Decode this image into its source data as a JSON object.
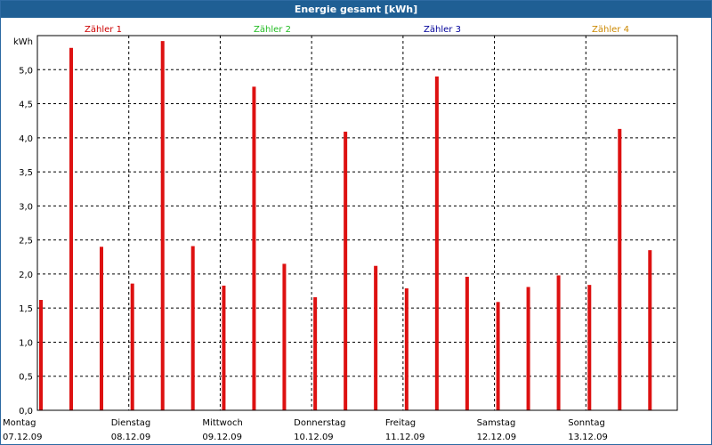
{
  "window": {
    "title": "Energie gesamt [kWh]"
  },
  "legend": [
    {
      "label": "Zähler 1",
      "color": "#cc0000"
    },
    {
      "label": "Zähler 2",
      "color": "#22bb22"
    },
    {
      "label": "Zähler 3",
      "color": "#000099"
    },
    {
      "label": "Zähler 4",
      "color": "#cc8800"
    }
  ],
  "chart_data": {
    "type": "bar",
    "title": "Energie gesamt [kWh]",
    "ylabel": "kWh",
    "ylim": [
      0,
      5.5
    ],
    "ytick_labels": [
      "0,0",
      "0,5",
      "1,0",
      "1,5",
      "2,0",
      "2,5",
      "3,0",
      "3,5",
      "4,0",
      "4,5",
      "5,0"
    ],
    "grid": true,
    "bar_color": "#dd1111",
    "days": [
      {
        "weekday": "Montag",
        "date": "07.12.09"
      },
      {
        "weekday": "Dienstag",
        "date": "08.12.09"
      },
      {
        "weekday": "Mittwoch",
        "date": "09.12.09"
      },
      {
        "weekday": "Donnerstag",
        "date": "10.12.09"
      },
      {
        "weekday": "Freitag",
        "date": "11.12.09"
      },
      {
        "weekday": "Samstag",
        "date": "12.12.09"
      },
      {
        "weekday": "Sonntag",
        "date": "13.12.09"
      }
    ],
    "series": [
      {
        "values": [
          1.62,
          5.32,
          2.4,
          1.86,
          5.42,
          2.41,
          1.83,
          4.75,
          2.15,
          1.66,
          4.09,
          2.12,
          1.79,
          4.9,
          1.96,
          1.59,
          1.81,
          1.98,
          1.84,
          4.13,
          2.35
        ]
      }
    ]
  }
}
